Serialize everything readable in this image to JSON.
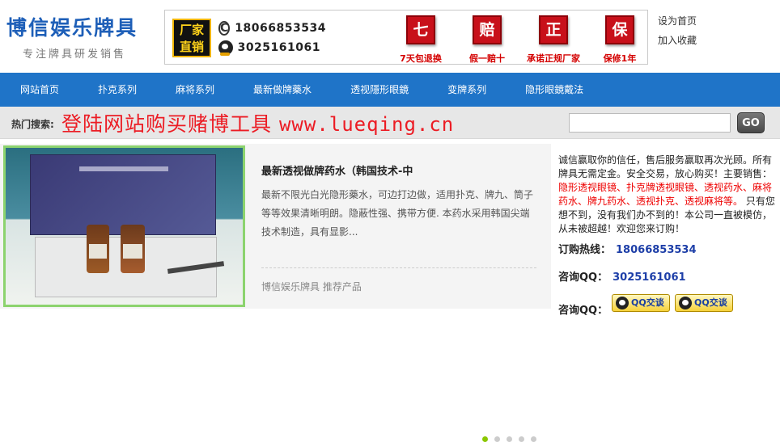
{
  "logo": {
    "main": "博信娱乐牌具",
    "sub": "专注牌具研发销售"
  },
  "header": {
    "factory_label_1": "厂家",
    "factory_label_2": "直销",
    "phone": "18066853534",
    "qq": "3025161061",
    "badges": [
      {
        "char": "七",
        "text": "7天包退换"
      },
      {
        "char": "赔",
        "text": "假一赔十"
      },
      {
        "char": "正",
        "text": "承诺正规厂家"
      },
      {
        "char": "保",
        "text": "保修1年"
      }
    ],
    "links": {
      "homepage": "设为首页",
      "favorite": "加入收藏"
    }
  },
  "nav": [
    "网站首页",
    "扑克系列",
    "麻将系列",
    "最新做牌藥水",
    "透视隱形眼鏡",
    "变牌系列",
    "隐形眼鏡戴法"
  ],
  "search": {
    "hot_label": "热门搜索:",
    "promo_text": "登陆网站购买赌博工具",
    "promo_url": "www.lueqing.cn",
    "go_label": "GO"
  },
  "feature": {
    "title": "最新透视做牌药水（韩国技术-中",
    "description": "最新不限光白光隐形藥水，可边打边做，适用扑克、牌九、筒子等等效果清晰明朗。隐蔽性强、携带方便. 本药水采用韩国尖端技术制造，具有显影...",
    "footer": "博信娱乐牌具 推荐产品",
    "slide_count": 5
  },
  "side": {
    "intro_1": "诚信赢取你的信任，售后服务赢取再次光顾。所有牌具无需定金。安全交易，放心购买！主要销售：",
    "intro_red": "隐形透视眼镜、扑克牌透视眼镜、透视药水、麻将药水、牌九药水、透视扑克、透视麻将等。",
    "intro_2": "只有您想不到，没有我们办不到的！本公司一直被模仿，从未被超越！欢迎您来订购！",
    "hotline_label": "订购热线：",
    "hotline": "18066853534",
    "qq_label": "咨询QQ：",
    "qq": "3025161061",
    "qq_label_2": "咨询QQ：",
    "qq_btn_1": "QQ交谈",
    "qq_btn_2": "QQ交谈"
  }
}
